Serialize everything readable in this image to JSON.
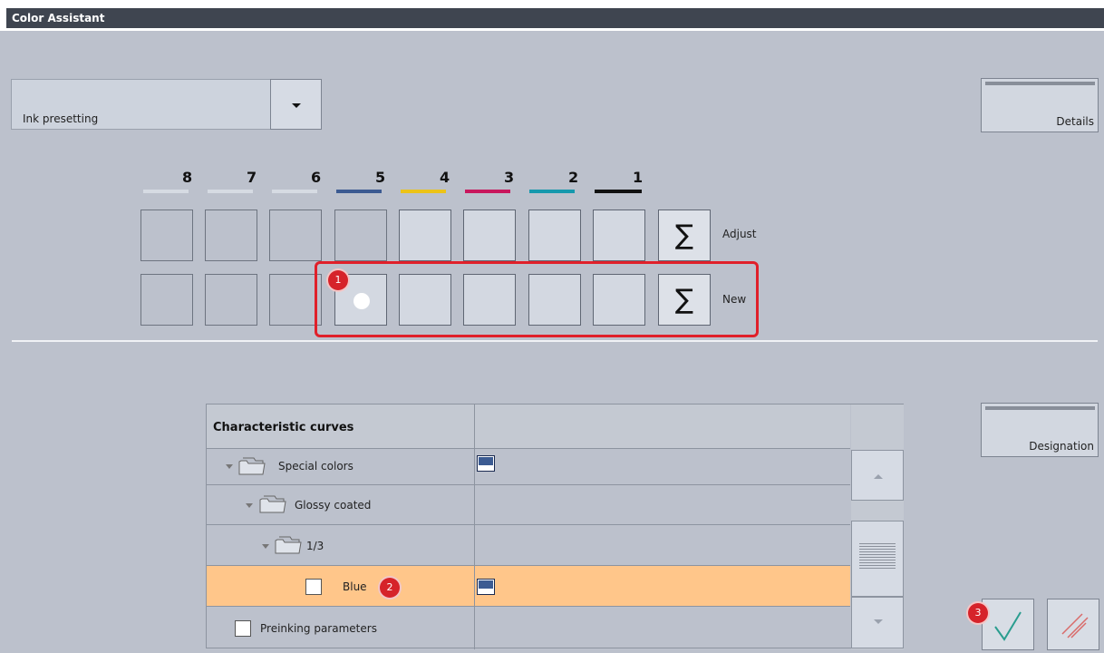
{
  "window": {
    "title": "Color Assistant"
  },
  "ink_dropdown": {
    "value": "Ink presetting"
  },
  "details_button": {
    "label": "Details"
  },
  "designation_button": {
    "label": "Designation"
  },
  "ink_units": [
    {
      "number": "8",
      "color": "#d6dbe3"
    },
    {
      "number": "7",
      "color": "#d6dbe3"
    },
    {
      "number": "6",
      "color": "#d6dbe3"
    },
    {
      "number": "5",
      "color": "#3c5b92"
    },
    {
      "number": "4",
      "color": "#ecc318"
    },
    {
      "number": "3",
      "color": "#c8175d"
    },
    {
      "number": "2",
      "color": "#1699ad"
    },
    {
      "number": "1",
      "color": "#111111"
    }
  ],
  "rows": {
    "adjust_label": "Adjust",
    "new_label": "New",
    "sum_symbol": "∑"
  },
  "badges": {
    "b1": "1",
    "b2": "2",
    "b3": "3"
  },
  "curves_table": {
    "header": "Characteristic curves",
    "rows": [
      {
        "label": "Special colors"
      },
      {
        "label": "Glossy coated"
      },
      {
        "label": "1/3"
      },
      {
        "label": "Blue",
        "selected": true
      },
      {
        "label": "Preinking parameters"
      }
    ]
  },
  "colors": {
    "selected_row": "#ffc68a",
    "badge": "#d6232a",
    "accent_blue": "#3c5b92"
  }
}
